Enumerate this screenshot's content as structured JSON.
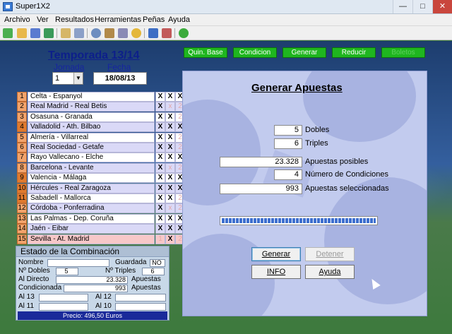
{
  "window": {
    "title": "Super1X2",
    "minimize": "—",
    "maximize": "□",
    "close": "✕"
  },
  "menu": [
    "Archivo",
    "Ver",
    "Resultados",
    "Herramientas",
    "Peñas",
    "Ayuda"
  ],
  "season": {
    "title": "Temporada 13/14",
    "jornada_label": "Jornada",
    "fecha_label": "Fecha",
    "jornada_value": "1",
    "fecha_value": "18/08/13"
  },
  "matches": [
    {
      "num": "1",
      "name": "Celta - Espanyol",
      "picks": [
        "X",
        "X",
        "X"
      ]
    },
    {
      "num": "2",
      "name": "Real Madrid - Real Betis",
      "picks": [
        "X",
        "x",
        "2"
      ]
    },
    {
      "num": "3",
      "name": "Osasuna - Granada",
      "picks": [
        "X",
        "X",
        "2"
      ]
    },
    {
      "num": "4",
      "name": "Valladolid - Ath. Bilbao",
      "picks": [
        "X",
        "X",
        "X"
      ]
    },
    {
      "num": "5",
      "name": "Almería - Villarreal",
      "picks": [
        "X",
        "X",
        "2"
      ]
    },
    {
      "num": "6",
      "name": "Real Sociedad - Getafe",
      "picks": [
        "X",
        "X",
        "2"
      ]
    },
    {
      "num": "7",
      "name": "Rayo Vallecano - Elche",
      "picks": [
        "X",
        "X",
        "X"
      ]
    },
    {
      "num": "8",
      "name": "Barcelona - Levante",
      "picks": [
        "X",
        "x",
        "2"
      ]
    },
    {
      "num": "9",
      "name": "Valencia - Málaga",
      "picks": [
        "X",
        "X",
        "X"
      ]
    },
    {
      "num": "10",
      "name": "Hércules - Real Zaragoza",
      "picks": [
        "X",
        "X",
        "X"
      ]
    },
    {
      "num": "11",
      "name": "Sabadell - Mallorca",
      "picks": [
        "X",
        "X",
        "2"
      ]
    },
    {
      "num": "12",
      "name": "Córdoba - Ponferradina",
      "picks": [
        "X",
        "x",
        "2"
      ]
    },
    {
      "num": "13",
      "name": "Las Palmas - Dep. Coruña",
      "picks": [
        "X",
        "X",
        "X"
      ]
    },
    {
      "num": "14",
      "name": "Jaén - Eibar",
      "picks": [
        "X",
        "X",
        "X"
      ]
    },
    {
      "num": "15",
      "name": "Sevilla - At. Madrid",
      "picks": [
        "1",
        "X",
        "2"
      ]
    }
  ],
  "combination": {
    "header": "Estado de la Combinación",
    "nombre_label": "Nombre",
    "nombre_value": "",
    "guardada_label": "Guardada",
    "guardada_value": "NO",
    "dobles_label": "Nº Dobles",
    "dobles_value": "5",
    "triples_label": "Nº Triples",
    "triples_value": "6",
    "directo_label": "Al Directo",
    "directo_value": "23.328",
    "directo_unit": "Apuestas",
    "condicionada_label": "Condicionada",
    "condicionada_value": "993",
    "condicionada_unit": "Apuestas",
    "al13_label": "Al 13",
    "al13_value": "",
    "al12_label": "Al 12",
    "al12_value": "",
    "al11_label": "Al 11",
    "al11_value": "",
    "al10_label": "Al 10",
    "al10_value": "",
    "price": "Precio: 496,50 Euros"
  },
  "top_buttons": [
    "Quin. Base",
    "Condicion",
    "Generar",
    "Reducir",
    "Boletos"
  ],
  "generate": {
    "title": "Generar Apuestas",
    "dobles_value": "5",
    "dobles_label": "Dobles",
    "triples_value": "6",
    "triples_label": "Triples",
    "posibles_value": "23.328",
    "posibles_label": "Apuestas posibles",
    "condiciones_value": "4",
    "condiciones_label": "Número de Condiciones",
    "seleccionadas_value": "993",
    "seleccionadas_label": "Apuestas seleccionadas",
    "progress": 1.0,
    "btn_generar": "Generar",
    "btn_detener": "Detener",
    "btn_info": "INFO",
    "btn_ayuda": "Ayuda"
  },
  "colors": {
    "accent_green": "#1fb61f",
    "title_blue": "#0d1f8a",
    "price_bar": "#1a2a9a"
  },
  "toolbar_icons": [
    "new-icon",
    "open-icon",
    "save-icon",
    "export-icon",
    "notes-icon",
    "search-icon",
    "globe-icon",
    "edit-icon",
    "list-icon",
    "coins-icon",
    "chart-icon",
    "printer-icon",
    "help-icon"
  ]
}
